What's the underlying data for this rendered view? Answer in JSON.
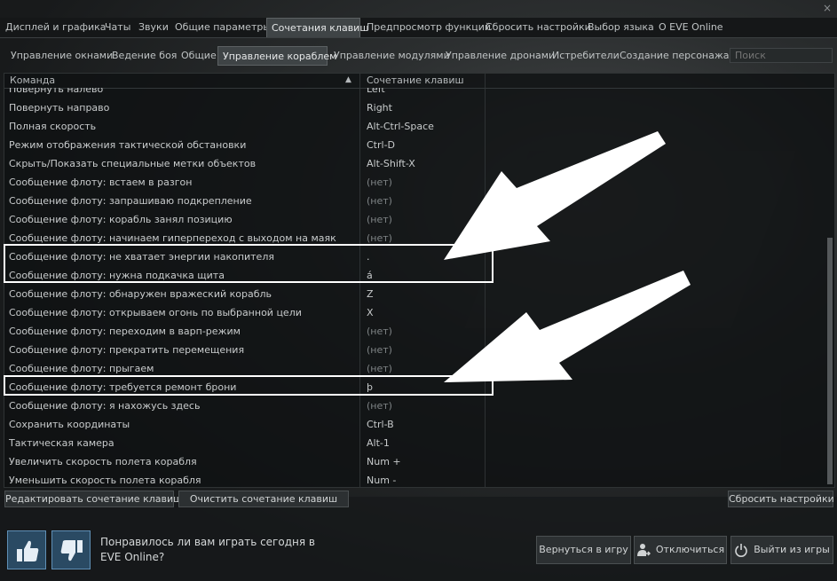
{
  "top_tabs": [
    {
      "label": "Дисплей и графика",
      "active": false
    },
    {
      "label": "Чаты",
      "active": false
    },
    {
      "label": "Звуки",
      "active": false
    },
    {
      "label": "Общие параметры",
      "active": false
    },
    {
      "label": "Сочетания клавиш",
      "active": true
    },
    {
      "label": "Предпросмотр функций",
      "active": false
    },
    {
      "label": "Сбросить настройки",
      "active": false
    },
    {
      "label": "Выбор языка",
      "active": false
    },
    {
      "label": "О EVE Online",
      "active": false
    }
  ],
  "close_glyph": "×",
  "sub_tabs": [
    {
      "label": "Управление окнами",
      "active": false
    },
    {
      "label": "Ведение боя",
      "active": false
    },
    {
      "label": "Общие",
      "active": false
    },
    {
      "label": "Управление кораблем",
      "active": true
    },
    {
      "label": "Управление модулями",
      "active": false
    },
    {
      "label": "Управление дронами",
      "active": false
    },
    {
      "label": "Истребители",
      "active": false
    },
    {
      "label": "Создание персонажа",
      "active": false
    }
  ],
  "search": {
    "placeholder": "Поиск"
  },
  "table": {
    "col_command": "Команда",
    "col_shortcut": "Сочетание клавиш",
    "sort_glyph": "▲",
    "rows": [
      {
        "cmd": "Повернуть налево",
        "key": "Left"
      },
      {
        "cmd": "Повернуть направо",
        "key": "Right"
      },
      {
        "cmd": "Полная скорость",
        "key": "Alt-Ctrl-Space"
      },
      {
        "cmd": "Режим отображения тактической обстановки",
        "key": "Ctrl-D"
      },
      {
        "cmd": "Скрыть/Показать специальные метки объектов",
        "key": "Alt-Shift-X"
      },
      {
        "cmd": "Сообщение флоту: встаем в разгон",
        "key": "(нет)"
      },
      {
        "cmd": "Сообщение флоту: запрашиваю подкрепление",
        "key": "(нет)"
      },
      {
        "cmd": "Сообщение флоту: корабль занял позицию",
        "key": "(нет)"
      },
      {
        "cmd": "Сообщение флоту: начинаем гиперпереход с выходом на маяк",
        "key": "(нет)"
      },
      {
        "cmd": "Сообщение флоту: не хватает энергии накопителя",
        "key": "."
      },
      {
        "cmd": "Сообщение флоту: нужна подкачка щита",
        "key": "á"
      },
      {
        "cmd": "Сообщение флоту: обнаружен вражеский корабль",
        "key": "Z"
      },
      {
        "cmd": "Сообщение флоту: открываем огонь по выбранной цели",
        "key": "X"
      },
      {
        "cmd": "Сообщение флоту: переходим в варп-режим",
        "key": "(нет)"
      },
      {
        "cmd": "Сообщение флоту: прекратить перемещения",
        "key": "(нет)"
      },
      {
        "cmd": "Сообщение флоту: прыгаем",
        "key": "(нет)"
      },
      {
        "cmd": "Сообщение флоту: требуется ремонт брони",
        "key": "þ"
      },
      {
        "cmd": "Сообщение флоту: я нахожусь здесь",
        "key": "(нет)"
      },
      {
        "cmd": "Сохранить координаты",
        "key": "Ctrl-B"
      },
      {
        "cmd": "Тактическая камера",
        "key": "Alt-1"
      },
      {
        "cmd": "Увеличить скорость полета корабля",
        "key": "Num +"
      },
      {
        "cmd": "Уменьшить скорость полета корабля",
        "key": "Num -"
      }
    ]
  },
  "buttons": {
    "edit": "Редактировать сочетание клавиш",
    "clear": "Очистить сочетание клавиш",
    "reset": "Сбросить настройки",
    "back": "Вернуться в игру",
    "disconnect": "Отключиться",
    "quit": "Выйти из игры"
  },
  "feedback": {
    "line1": "Понравилось ли вам играть сегодня в",
    "line2": "EVE Online?"
  },
  "colors": {
    "thumb_bg": "#2a4a63",
    "highlight": "#ffffff"
  }
}
